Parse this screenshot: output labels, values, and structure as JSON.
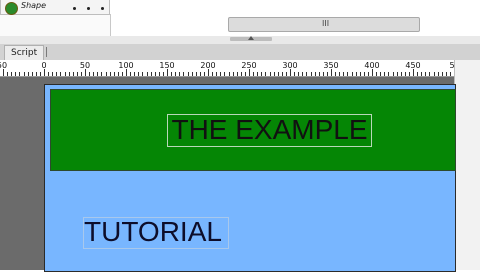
{
  "timeline": {
    "layer_label": "Shape",
    "scroll_grip": "III"
  },
  "tabs": [
    {
      "label": "Script"
    }
  ],
  "ruler": {
    "labels": [
      "50",
      "0",
      "50",
      "100",
      "150",
      "200",
      "250",
      "300",
      "350",
      "400",
      "450",
      "5"
    ]
  },
  "stage": {
    "title_text": "THE EXAMPLE",
    "subtitle_text": "TUTORIAL",
    "colors": {
      "stage_bg": "#78b6ff",
      "header_fill": "#058605"
    }
  }
}
